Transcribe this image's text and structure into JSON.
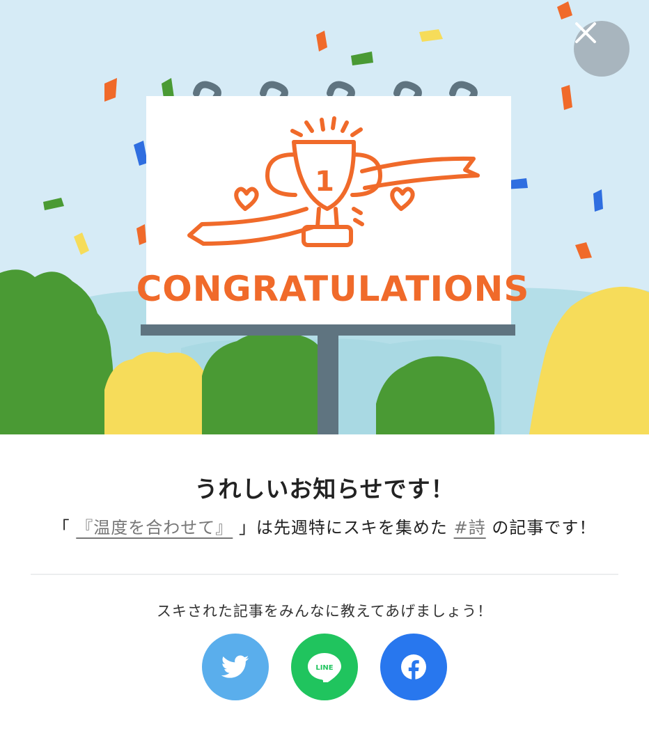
{
  "hero": {
    "sign_text": "CONGRATULATIONS",
    "trophy_rank": "1",
    "colors": {
      "sky": "#d6ebf6",
      "orange": "#f06a2a",
      "green": "#4a9a34",
      "yellow": "#f6dc5a",
      "pole": "#5f7480"
    }
  },
  "close": {
    "icon": "close-icon"
  },
  "notice": {
    "title": "うれしいお知らせです！",
    "quote_open": "「",
    "article_title": "『温度を合わせて』",
    "middle_text": "」は先週特にスキを集めた",
    "hashtag": "#詩",
    "tail_text": "の記事です！"
  },
  "share": {
    "prompt": "スキされた記事をみんなに教えてあげましょう！",
    "buttons": [
      {
        "name": "twitter",
        "icon": "twitter-icon",
        "color": "#5aaeec"
      },
      {
        "name": "line",
        "icon": "line-icon",
        "label": "LINE",
        "color": "#20c45e"
      },
      {
        "name": "facebook",
        "icon": "facebook-icon",
        "color": "#2877ee"
      }
    ]
  }
}
